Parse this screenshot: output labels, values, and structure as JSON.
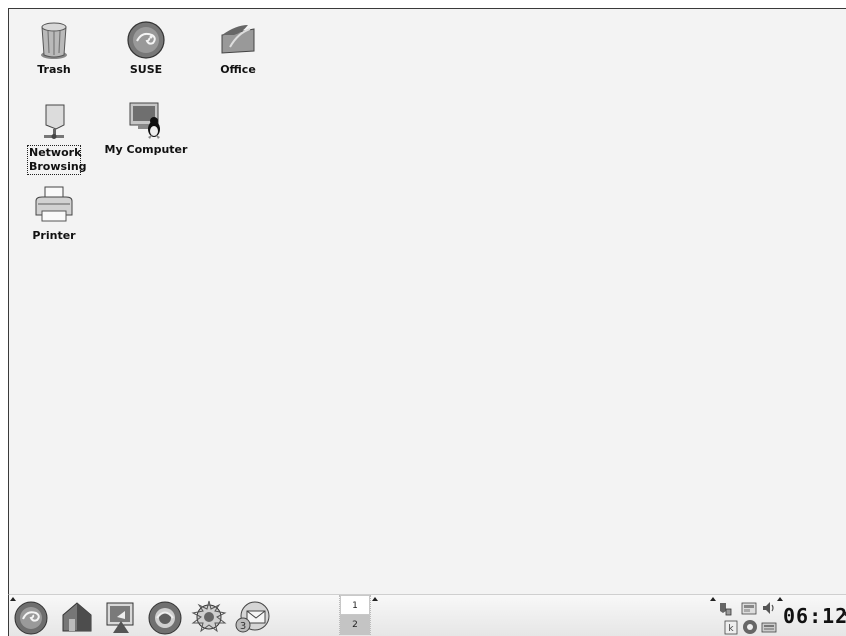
{
  "desktop": {
    "icons": [
      {
        "label": "Trash",
        "icon": "trash-icon"
      },
      {
        "label": "SUSE",
        "icon": "suse-icon"
      },
      {
        "label": "Office",
        "icon": "office-icon"
      },
      {
        "label": "Network Browsing",
        "icon": "network-icon",
        "selected": true
      },
      {
        "label": "My Computer",
        "icon": "computer-icon"
      },
      {
        "label": "Printer",
        "icon": "printer-icon"
      }
    ]
  },
  "taskbar": {
    "launchers": [
      {
        "icon": "suse-menu-icon"
      },
      {
        "icon": "home-icon"
      },
      {
        "icon": "show-desktop-icon"
      },
      {
        "icon": "web-browser-icon"
      },
      {
        "icon": "help-icon"
      },
      {
        "icon": "mail-icon"
      }
    ],
    "pager": {
      "desktops": [
        "1",
        "2"
      ],
      "active": "1"
    },
    "tray": [
      {
        "icon": "network-tray-icon"
      },
      {
        "icon": "update-tray-icon"
      },
      {
        "icon": "volume-icon"
      },
      {
        "icon": "klipper-icon"
      },
      {
        "icon": "info-tray-icon"
      },
      {
        "icon": "keyboard-icon"
      }
    ],
    "clock": "06:12"
  }
}
